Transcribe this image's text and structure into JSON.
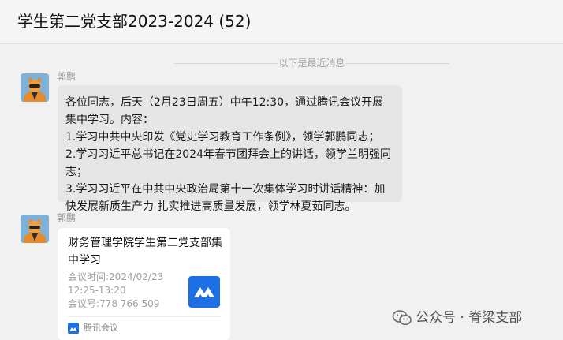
{
  "header": {
    "title": "学生第二党支部2023-2024 (52)"
  },
  "divider": {
    "text": "以下是最近消息"
  },
  "messages": [
    {
      "sender": "郭鹏",
      "lines": [
        "各位同志，后天（2月23日周五）中午12:30，通过腾讯会议开展集中学习。内容：",
        "1.学习中共中央印发《党史学习教育工作条例》，领学郭鹏同志；",
        "2.学习习近平总书记在2024年春节团拜会上的讲话，领学兰明强同志；",
        "3.学习习近平在中共中央政治局第十一次集体学习时讲话精神：加快发展新质生产力 扎实推进高质量发展，领学林夏茹同志。"
      ]
    },
    {
      "sender": "郭鹏",
      "card": {
        "title": "财务管理学院学生第二党支部集中学习",
        "time": "会议时间:2024/02/23 12:25-13:20",
        "id": "会议号:778 766 509",
        "app": "腾讯会议",
        "logo_icon": "tencent-meeting-icon",
        "accent": "#1d6fe5"
      }
    }
  ],
  "watermark": {
    "text": "公众号 · 脊梁支部",
    "icon": "wechat-icon"
  }
}
